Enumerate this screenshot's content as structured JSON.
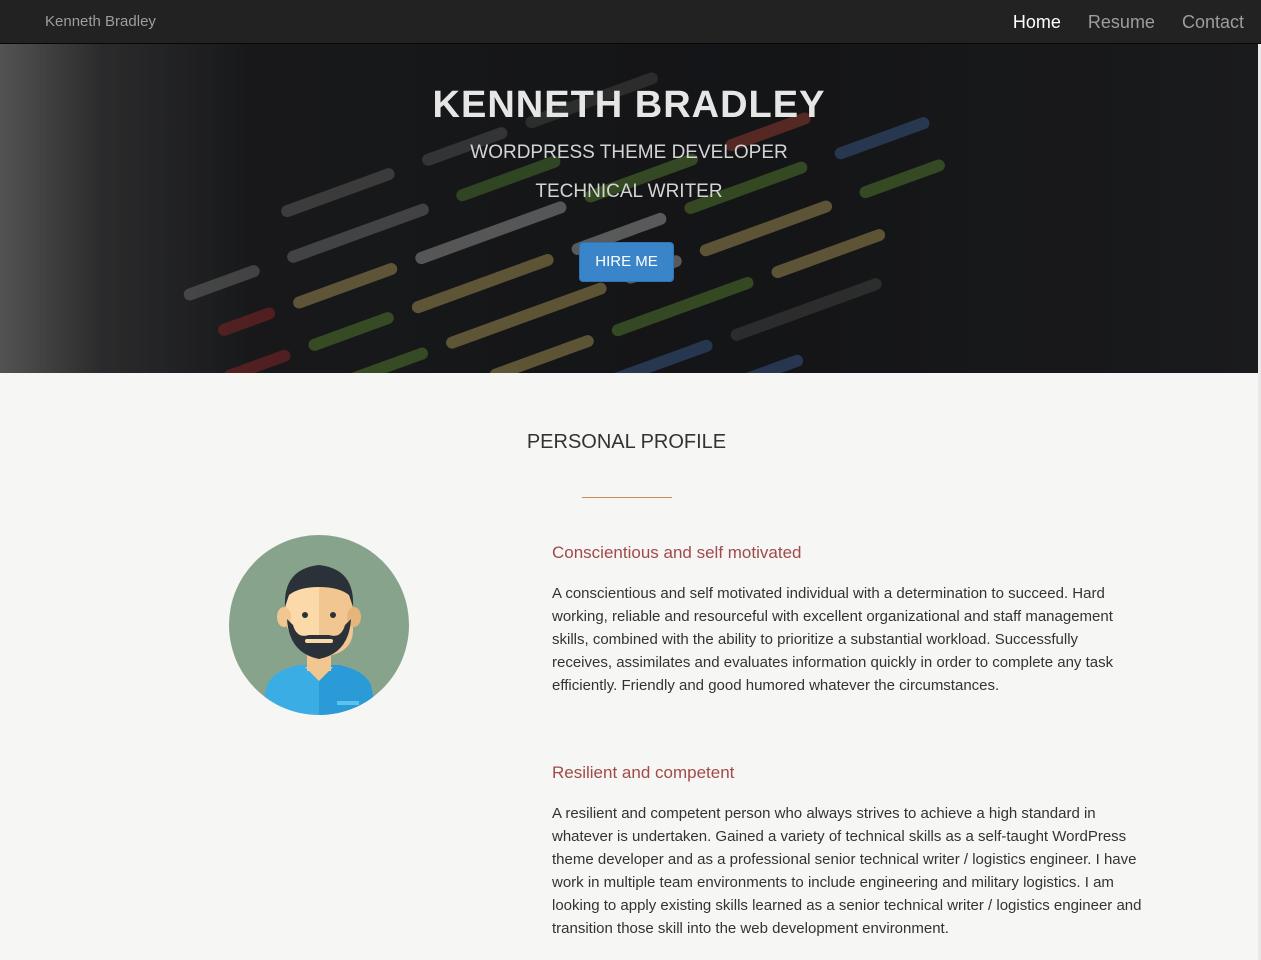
{
  "navbar": {
    "brand": "Kenneth Bradley",
    "links": [
      {
        "label": "Home",
        "active": true
      },
      {
        "label": "Resume",
        "active": false
      },
      {
        "label": "Contact",
        "active": false
      }
    ]
  },
  "hero": {
    "title": "KENNETH BRADLEY",
    "subtitle_1": "WORDPRESS THEME DEVELOPER",
    "subtitle_2": "TECHNICAL WRITER",
    "button_label": "HIRE ME",
    "button_color": "#3a85c9"
  },
  "profile": {
    "section_title": "PERSONAL PROFILE",
    "accent_color": "#d08c4a",
    "heading_color": "#a14a4a",
    "avatar_icon": "bearded-man-avatar-icon",
    "blocks": [
      {
        "heading": "Conscientious and self motivated",
        "text": "A conscientious and self motivated individual with a determination to succeed. Hard working, reliable and resourceful with excellent organizational and staff management skills, combined with the ability to prioritize a substantial workload. Successfully receives, assimilates and evaluates information quickly in order to complete any task efficiently. Friendly and good humored whatever the circumstances."
      },
      {
        "heading": "Resilient and competent",
        "text": "A resilient and competent person who always strives to achieve a high standard in whatever is undertaken. Gained a variety of technical skills as a self-taught WordPress theme developer and as a professional senior technical writer / logistics engineer. I have work in multiple team environments to include engineering and military logistics. I am looking to apply existing skills learned as a senior technical writer / logistics engineer and transition those skill into the web development environment."
      }
    ]
  }
}
